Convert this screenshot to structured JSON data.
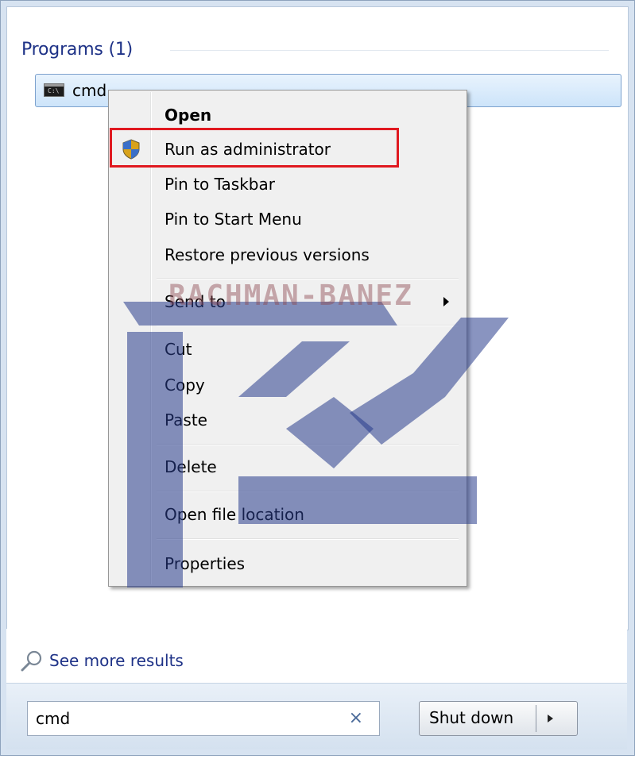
{
  "programs": {
    "heading": "Programs (1)",
    "result_label": "cmd",
    "cmd_icon_text": "C:\\"
  },
  "context_menu": {
    "items": [
      {
        "label": "Open",
        "bold": true
      },
      {
        "label": "Run as administrator",
        "icon": "uac-shield-icon",
        "highlighted": true
      },
      {
        "label": "Pin to Taskbar"
      },
      {
        "label": "Pin to Start Menu"
      },
      {
        "label": "Restore previous versions"
      },
      {
        "label": "Send to",
        "submenu": true
      },
      {
        "label": "Cut"
      },
      {
        "label": "Copy"
      },
      {
        "label": "Paste"
      },
      {
        "label": "Delete"
      },
      {
        "label": "Open file location"
      },
      {
        "label": "Properties"
      }
    ],
    "highlight_color": "#e01920"
  },
  "watermark": {
    "text": "RACHMAN-BANEZ"
  },
  "footer": {
    "see_more_label": "See more results",
    "search_value": "cmd",
    "clear_glyph": "×",
    "shutdown_label": "Shut down"
  },
  "colors": {
    "link": "#1e3287",
    "selection": "#cde4fa"
  }
}
